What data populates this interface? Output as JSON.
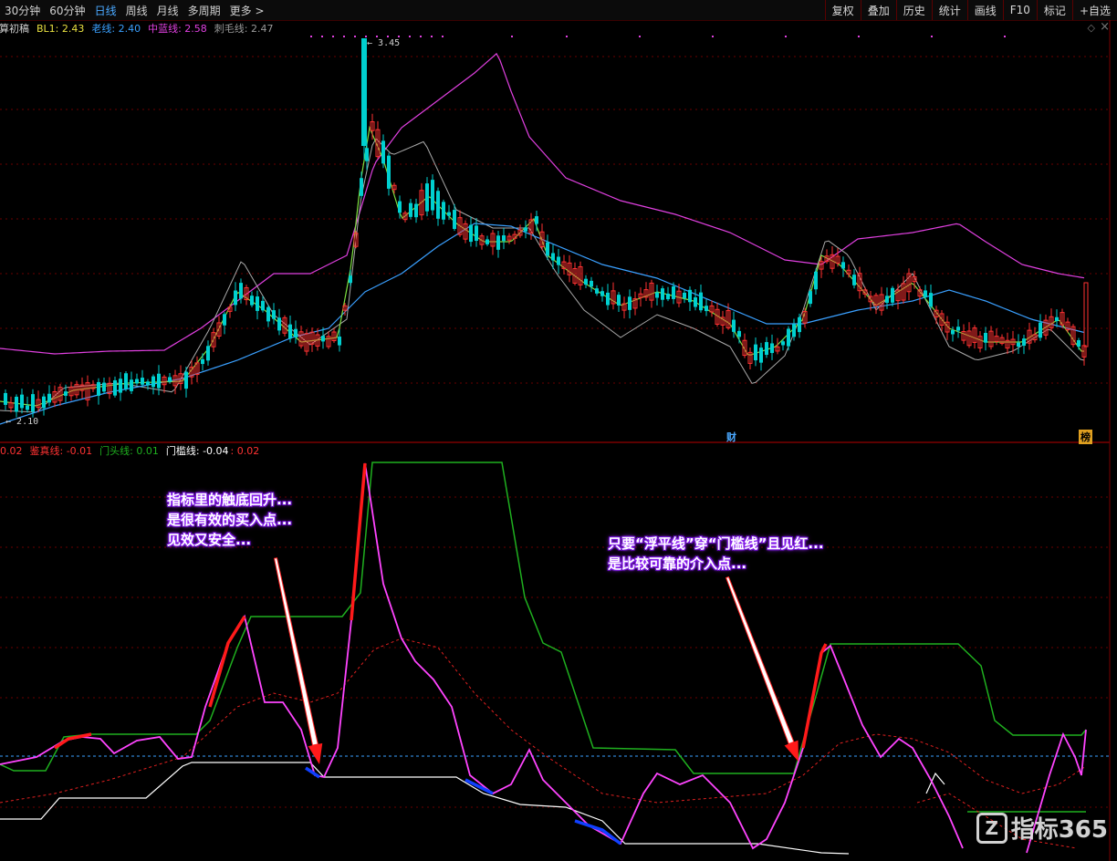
{
  "toolbar": {
    "periods": [
      "30分钟",
      "60分钟",
      "日线",
      "周线",
      "月线",
      "多周期",
      "更多 >"
    ],
    "active": "日线",
    "actions": [
      "复权",
      "叠加",
      "历史",
      "统计",
      "画线",
      "F10",
      "标记",
      "+自选"
    ]
  },
  "main_legend": {
    "name": "精算初稿",
    "bl1": "BL1: 2.43",
    "laoxian": "老线: 2.40",
    "zhonglan": "中蓝线: 2.58",
    "cimao": "刺毛线: 2.47"
  },
  "sub_legend": {
    "lead": "0.02",
    "jianzhen": "鉴真线: -0.01",
    "mentou": "门头线: 0.01",
    "menkan": "门槛线: -0.04",
    "tail": ": 0.02"
  },
  "price_labels": {
    "high": "3.45",
    "low": "2.10"
  },
  "markers": {
    "cai": "财",
    "bang": "榜"
  },
  "annotations": {
    "left": [
      "指标里的触底回升...",
      "是很有效的买入点...",
      "见效又安全..."
    ],
    "right": [
      "只要“浮平线”穿“门槛线”且见红...",
      "是比较可靠的介入点..."
    ]
  },
  "watermark": {
    "logo": "Z",
    "text": "指标365"
  },
  "colors": {
    "up": "#ff3232",
    "down": "#00d0d0",
    "ma_short": "#ffe000",
    "ma_mid": "#3aa0ff",
    "upper": "#e040e0",
    "lower": "#bbbbbb",
    "green_line": "#1fb01f",
    "magenta": "#ff44ff",
    "white": "#ffffff",
    "grid": "#6a0000"
  }
}
